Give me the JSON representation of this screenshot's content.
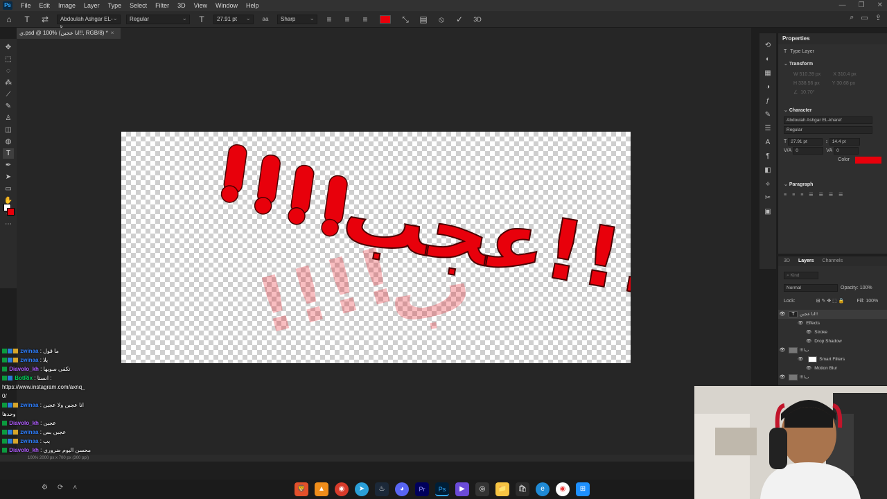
{
  "menubar": {
    "logo": "Ps",
    "items": [
      "File",
      "Edit",
      "Image",
      "Layer",
      "Type",
      "Select",
      "Filter",
      "3D",
      "View",
      "Window",
      "Help"
    ]
  },
  "options": {
    "font_family": "Abdoulah Ashgar EL-k...",
    "font_style": "Regular",
    "font_size": "27.91 pt",
    "aa_label": "aa",
    "anti_alias": "Sharp",
    "text_color": "#e8000b"
  },
  "document": {
    "tab_title": "ي.psd @ 100% (انا عجبن!!, RGB/8) *",
    "artwork_text": "عجب!!!!",
    "artwork_color": "#e8000b"
  },
  "properties": {
    "title": "Properties",
    "type_layer": "Type Layer",
    "transform_label": "Transform",
    "w": "W 510.39 px",
    "h": "H 338.56 px",
    "x": "X 310.4 px",
    "y": "Y 30.68 px",
    "angle": "10.70°",
    "character_label": "Character",
    "font_family": "Abdoulah Ashgar EL-kharef",
    "font_style": "Regular",
    "size": "27.91 pt",
    "leading": "14.4 pt",
    "kerning": "0",
    "tracking": "0",
    "color_label": "Color",
    "paragraph_label": "Paragraph"
  },
  "layers": {
    "tab_3d": "3D",
    "tab_layers": "Layers",
    "tab_channels": "Channels",
    "kind_placeholder": "Kind",
    "blend_mode": "Normal",
    "opacity_label": "Opacity:",
    "opacity": "100%",
    "lock_label": "Lock:",
    "fill_label": "Fill:",
    "fill": "100%",
    "rows": [
      {
        "name": "انا عجبن!!",
        "kind": "text"
      },
      {
        "name": "Effects",
        "kind": "effects"
      },
      {
        "name": "Stroke",
        "kind": "effect"
      },
      {
        "name": "Drop Shadow",
        "kind": "effect"
      },
      {
        "name": "!!!!ب",
        "kind": "smart"
      },
      {
        "name": "Smart Filters",
        "kind": "filters"
      },
      {
        "name": "Motion Blur",
        "kind": "filter"
      },
      {
        "name": "!!!!ب",
        "kind": "smart"
      }
    ]
  },
  "chat": [
    {
      "user": "zwinaa",
      "text": "ما قول",
      "color": "#2e7fff"
    },
    {
      "user": "zwinaa",
      "text": "يلا",
      "color": "#2e7fff"
    },
    {
      "user": "Diavolo_kh",
      "text": "تكفى سويها",
      "color": "#b05cff"
    },
    {
      "user": "BotRix",
      "text": "انستا :",
      "color": "#00d35a"
    },
    {
      "user": "",
      "text": "https://www.instagram.com/axnq_",
      "color": ""
    },
    {
      "user": "",
      "text": "0/",
      "color": ""
    },
    {
      "user": "zwinaa",
      "text": "انا عجبن ولا عجبن",
      "color": "#2e7fff"
    },
    {
      "user": "",
      "text": "وحدها",
      "color": ""
    },
    {
      "user": "Diavolo_kh",
      "text": "عجبن",
      "color": "#b05cff"
    },
    {
      "user": "zwinaa",
      "text": "عجبن بس",
      "color": "#2e7fff"
    },
    {
      "user": "zwinaa",
      "text": "بب",
      "color": "#2e7fff"
    },
    {
      "user": "Diavolo_kh",
      "text": "محسن اليوم ضروري",
      "color": "#b05cff"
    }
  ],
  "statusbar": {
    "text": "100%    2000 px x 700 px (300 ppi)"
  }
}
